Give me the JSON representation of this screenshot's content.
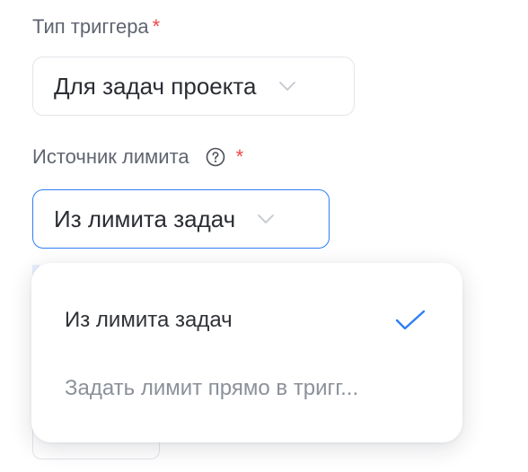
{
  "trigger_type": {
    "label": "Тип триггера",
    "required_mark": "*",
    "selected_value": "Для задач проекта"
  },
  "limit_source": {
    "label": "Источник лимита",
    "required_mark": "*",
    "selected_value": "Из лимита задач"
  },
  "dropdown": {
    "options": [
      {
        "label": "Из лимита задач",
        "selected": true
      },
      {
        "label": "Задать лимит прямо в тригг..."
      }
    ]
  },
  "colors": {
    "accent": "#2f7ef5",
    "required": "#ef4444",
    "label_text": "#5f6470",
    "muted_text": "#8b9099"
  },
  "icons": {
    "help": "question-circle-icon",
    "chevron": "chevron-down-icon",
    "check": "check-icon"
  }
}
